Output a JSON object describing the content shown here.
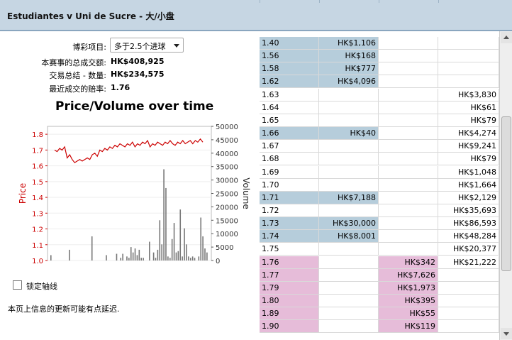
{
  "header": {
    "title": "Estudiantes v Uni de Sucre - 大/小盘"
  },
  "form": {
    "bet_type_label": "博彩项目:",
    "bet_type_value": "多于2.5个进球",
    "total_matched_label": "本赛事的总成交额:",
    "total_matched_value": "HK$408,925",
    "volume_label": "交易总结 - 数量:",
    "volume_value": "HK$234,575",
    "last_price_label": "最近成交的赔率:",
    "last_price_value": "1.76"
  },
  "chart_data": {
    "type": "line",
    "title": "Price/Volume over time",
    "ylabel": "Price",
    "y2label": "Volume",
    "ylim": [
      1.0,
      1.85
    ],
    "y2lim": [
      0,
      50000
    ],
    "yticks": [
      "1.8",
      "1.7",
      "1.6",
      "1.5",
      "1.4",
      "1.3",
      "1.2",
      "1.1",
      "1.0"
    ],
    "y2ticks": [
      "50000",
      "45000",
      "40000",
      "35000",
      "30000",
      "25000",
      "20000",
      "15000",
      "10000",
      "5000",
      "0"
    ],
    "price_color": "#cc0000",
    "volume_color": "#777777",
    "price": [
      1.7,
      1.69,
      1.71,
      1.7,
      1.72,
      1.65,
      1.67,
      1.64,
      1.62,
      1.63,
      1.64,
      1.63,
      1.64,
      1.65,
      1.64,
      1.67,
      1.68,
      1.66,
      1.7,
      1.69,
      1.71,
      1.7,
      1.72,
      1.71,
      1.73,
      1.72,
      1.74,
      1.73,
      1.72,
      1.74,
      1.73,
      1.75,
      1.72,
      1.74,
      1.73,
      1.75,
      1.74,
      1.76,
      1.72,
      1.74,
      1.73,
      1.75,
      1.74,
      1.73,
      1.75,
      1.74,
      1.76,
      1.74,
      1.73,
      1.75,
      1.74,
      1.76,
      1.74,
      1.75,
      1.76,
      1.74,
      1.76,
      1.75,
      1.77,
      1.75
    ],
    "volume": [
      2000,
      0,
      0,
      0,
      0,
      0,
      0,
      0,
      0,
      4000,
      0,
      0,
      0,
      0,
      0,
      0,
      0,
      0,
      0,
      0,
      9000,
      0,
      0,
      0,
      0,
      0,
      0,
      2000,
      0,
      0,
      0,
      0,
      2500,
      0,
      1000,
      2500,
      0,
      1500,
      1000,
      5000,
      3000,
      4500,
      2000,
      4000,
      1000,
      1000,
      0,
      0,
      7000,
      0,
      3000,
      1000,
      4000,
      15000,
      6000,
      34000,
      27000,
      1500,
      1000,
      8000,
      14000,
      3000,
      3500,
      19000,
      1500,
      12000,
      6000,
      1500,
      1000,
      1500,
      1000,
      0,
      1500,
      16000,
      9000,
      4500,
      3000
    ]
  },
  "lock_axis_label": "锁定轴线",
  "footer_note": "本页上信息的更新可能有点延迟.",
  "colors": {
    "back": "#b6cddb",
    "lay": "#e6bcd9"
  },
  "table": {
    "rows": [
      {
        "price": "1.40",
        "back": "HK$1,106",
        "lay": "",
        "traded": "",
        "type": "back"
      },
      {
        "price": "1.56",
        "back": "HK$168",
        "lay": "",
        "traded": "",
        "type": "back"
      },
      {
        "price": "1.58",
        "back": "HK$777",
        "lay": "",
        "traded": "",
        "type": "back"
      },
      {
        "price": "1.62",
        "back": "HK$4,096",
        "lay": "",
        "traded": "",
        "type": "back"
      },
      {
        "price": "1.63",
        "back": "",
        "lay": "",
        "traded": "HK$3,830",
        "type": "none"
      },
      {
        "price": "1.64",
        "back": "",
        "lay": "",
        "traded": "HK$61",
        "type": "none"
      },
      {
        "price": "1.65",
        "back": "",
        "lay": "",
        "traded": "HK$79",
        "type": "none"
      },
      {
        "price": "1.66",
        "back": "HK$40",
        "lay": "",
        "traded": "HK$4,274",
        "type": "back"
      },
      {
        "price": "1.67",
        "back": "",
        "lay": "",
        "traded": "HK$9,241",
        "type": "none"
      },
      {
        "price": "1.68",
        "back": "",
        "lay": "",
        "traded": "HK$79",
        "type": "none"
      },
      {
        "price": "1.69",
        "back": "",
        "lay": "",
        "traded": "HK$1,048",
        "type": "none"
      },
      {
        "price": "1.70",
        "back": "",
        "lay": "",
        "traded": "HK$1,664",
        "type": "none"
      },
      {
        "price": "1.71",
        "back": "HK$7,188",
        "lay": "",
        "traded": "HK$2,129",
        "type": "back"
      },
      {
        "price": "1.72",
        "back": "",
        "lay": "",
        "traded": "HK$35,693",
        "type": "none"
      },
      {
        "price": "1.73",
        "back": "HK$30,000",
        "lay": "",
        "traded": "HK$86,593",
        "type": "back"
      },
      {
        "price": "1.74",
        "back": "HK$8,001",
        "lay": "",
        "traded": "HK$48,284",
        "type": "back"
      },
      {
        "price": "1.75",
        "back": "",
        "lay": "",
        "traded": "HK$20,377",
        "type": "none"
      },
      {
        "price": "1.76",
        "back": "",
        "lay": "HK$342",
        "traded": "HK$21,222",
        "type": "lay"
      },
      {
        "price": "1.77",
        "back": "",
        "lay": "HK$7,626",
        "traded": "",
        "type": "lay"
      },
      {
        "price": "1.79",
        "back": "",
        "lay": "HK$1,973",
        "traded": "",
        "type": "lay"
      },
      {
        "price": "1.80",
        "back": "",
        "lay": "HK$395",
        "traded": "",
        "type": "lay"
      },
      {
        "price": "1.89",
        "back": "",
        "lay": "HK$55",
        "traded": "",
        "type": "lay"
      },
      {
        "price": "1.90",
        "back": "",
        "lay": "HK$119",
        "traded": "",
        "type": "lay"
      }
    ]
  }
}
